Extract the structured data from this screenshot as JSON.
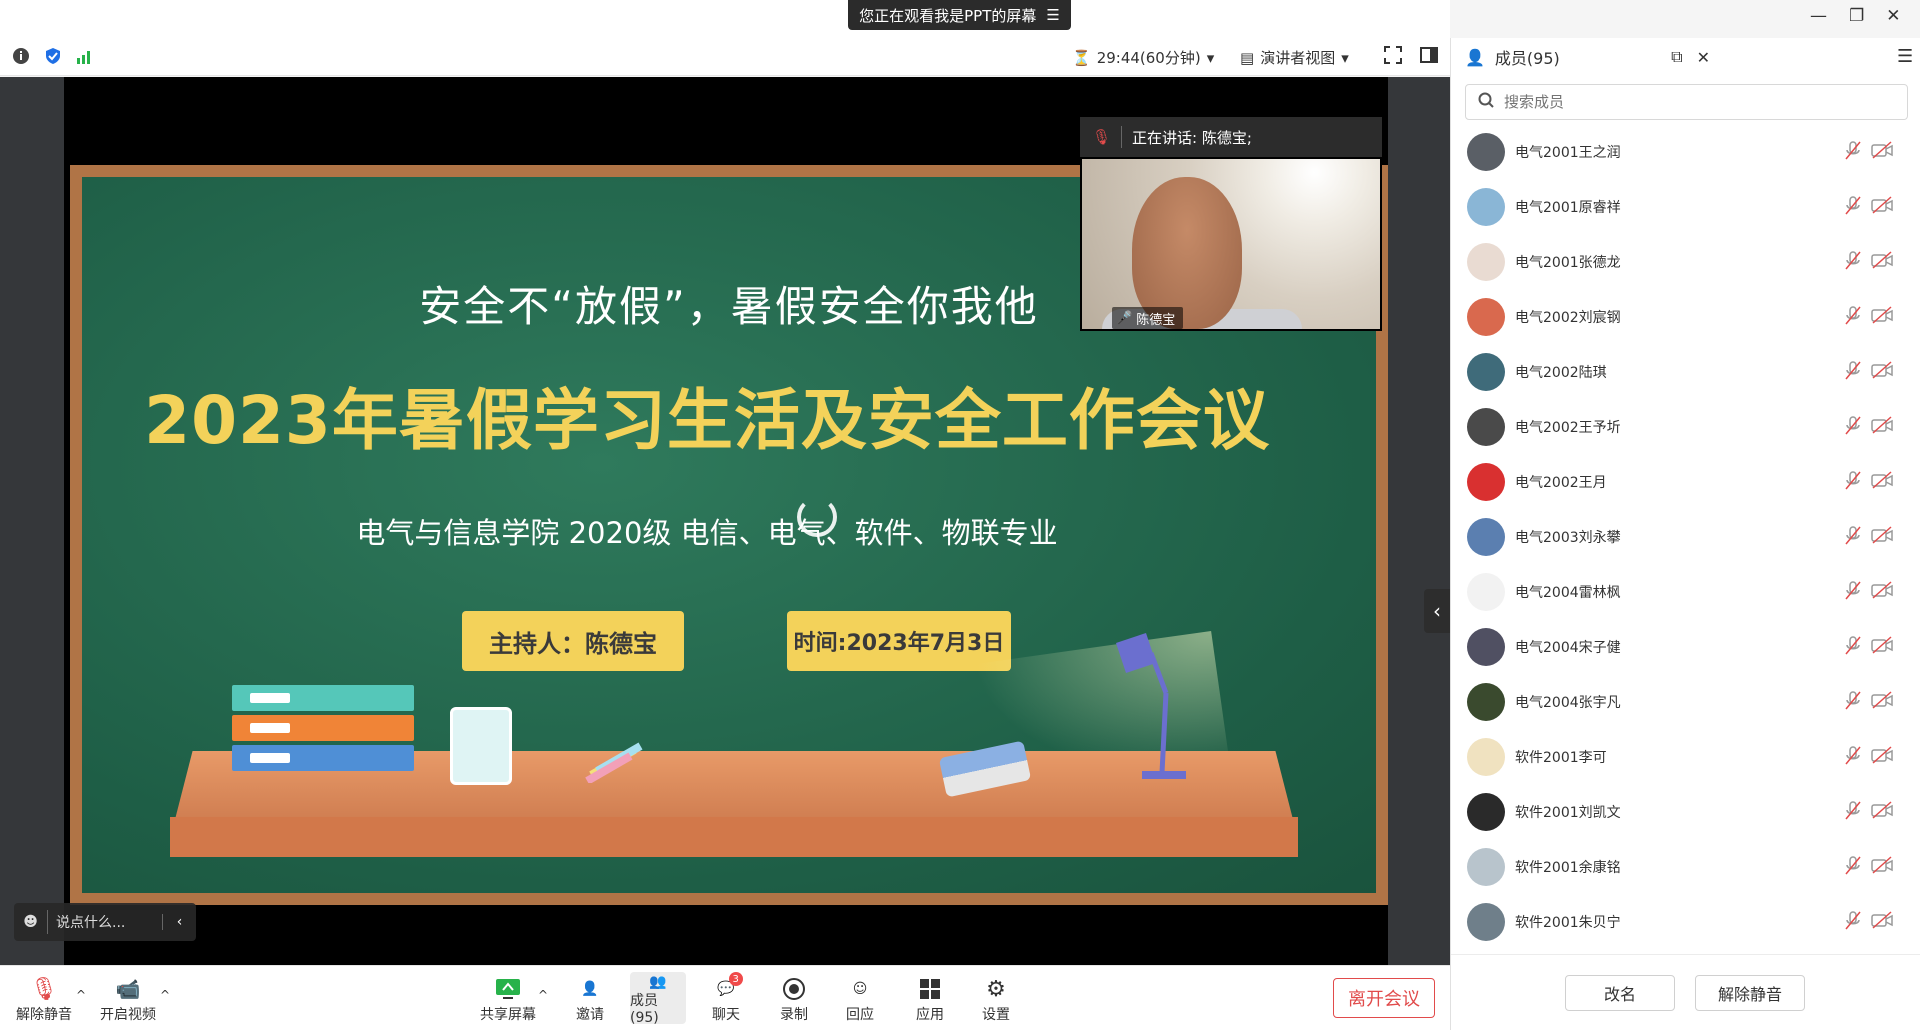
{
  "window": {
    "share_banner": "您正在观看我是PPT的屏幕",
    "menu_icon": "list-icon",
    "minimize": "—",
    "maximize": "❐",
    "close": "✕"
  },
  "toolbar": {
    "timer": "29:44(60分钟)",
    "view_mode": "演讲者视图"
  },
  "slide": {
    "subtitle": "安全不“放假”，暑假安全你我他",
    "title": "2023年暑假学习生活及安全工作会议",
    "department_line": "电气与信息学院  2020级  电信、电气、软件、物联专业",
    "host": "主持人：陈德宝",
    "time": "时间:2023年7月3日"
  },
  "speaker": {
    "label": "正在讲话:  陈德宝;",
    "name": "陈德宝"
  },
  "chat_input": {
    "placeholder": "说点什么..."
  },
  "bottombar": {
    "unmute": "解除静音",
    "start_video": "开启视频",
    "share_screen": "共享屏幕",
    "invite": "邀请",
    "members": "成员(95)",
    "chat": "聊天",
    "chat_badge": "3",
    "record": "录制",
    "reaction": "回应",
    "apps": "应用",
    "settings": "设置",
    "leave": "离开会议"
  },
  "panel": {
    "title": "成员(95)",
    "search_placeholder": "搜索成员",
    "members": [
      {
        "name": "电气2001王之润",
        "avatar_color": "#5a5f66"
      },
      {
        "name": "电气2001原睿祥",
        "avatar_color": "#8ab6d6"
      },
      {
        "name": "电气2001张德龙",
        "avatar_color": "#e9dbd2"
      },
      {
        "name": "电气2002刘宸钢",
        "avatar_color": "#d9694e"
      },
      {
        "name": "电气2002陆琪",
        "avatar_color": "#3f6b7a"
      },
      {
        "name": "电气2002王予圻",
        "avatar_color": "#4a4a4a"
      },
      {
        "name": "电气2002王月",
        "avatar_color": "#d93030"
      },
      {
        "name": "电气2003刘永攀",
        "avatar_color": "#5b7fb0"
      },
      {
        "name": "电气2004雷林枫",
        "avatar_color": "#f2f2f2"
      },
      {
        "name": "电气2004宋子健",
        "avatar_color": "#505062"
      },
      {
        "name": "电气2004张宇凡",
        "avatar_color": "#3a4a2e"
      },
      {
        "name": "软件2001李可",
        "avatar_color": "#f0e2c0"
      },
      {
        "name": "软件2001刘凯文",
        "avatar_color": "#2a2a2a"
      },
      {
        "name": "软件2001余康铭",
        "avatar_color": "#b8c4cc"
      },
      {
        "name": "软件2001朱贝宁",
        "avatar_color": "#6f7f8a"
      }
    ],
    "rename_button": "改名",
    "unmute_button": "解除静音"
  },
  "colors": {
    "accent": "#1f6fe5",
    "danger": "#e14b4b",
    "slide_yellow": "#f3d25a"
  }
}
